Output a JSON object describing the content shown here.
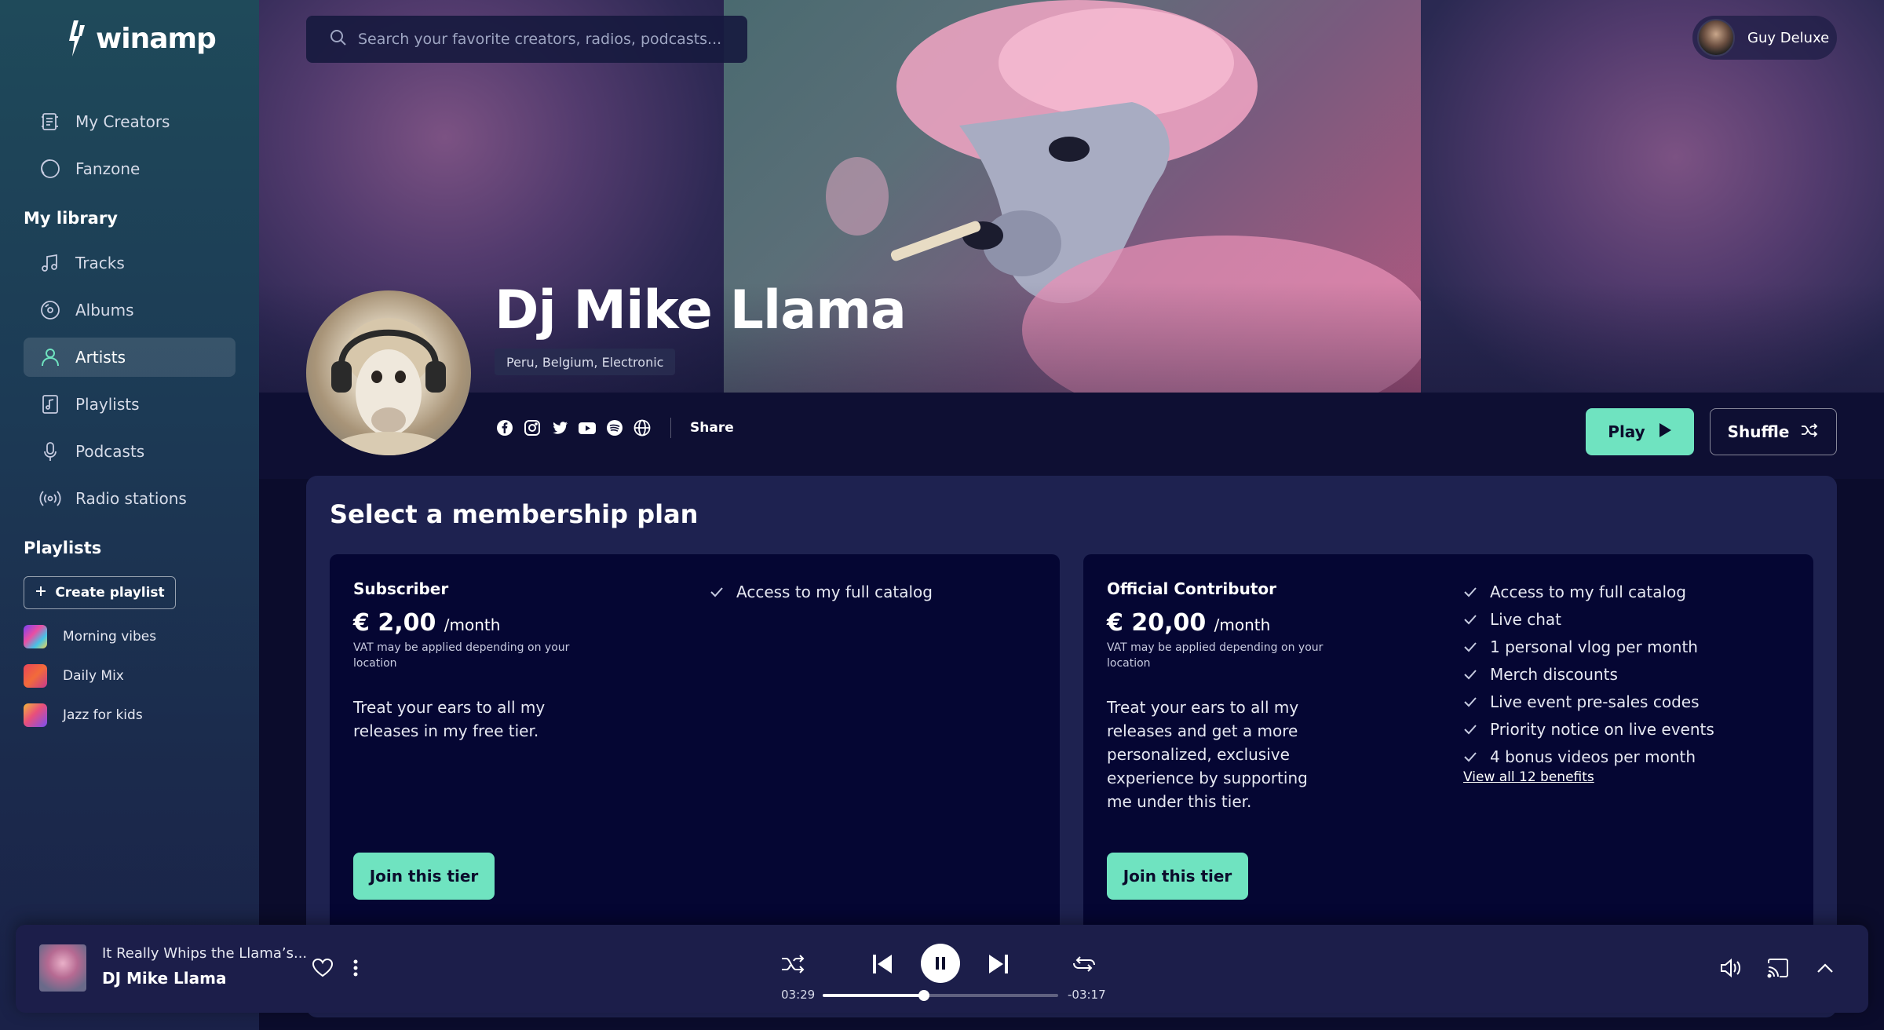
{
  "app": {
    "name": "winamp"
  },
  "nav": {
    "my_creators": "My Creators",
    "fanzone": "Fanzone",
    "library_title": "My library",
    "tracks": "Tracks",
    "albums": "Albums",
    "artists": "Artists",
    "playlists": "Playlists",
    "podcasts": "Podcasts",
    "radio": "Radio stations"
  },
  "playlists_section": {
    "title": "Playlists",
    "create_label": "Create playlist",
    "items": [
      {
        "label": "Morning vibes"
      },
      {
        "label": "Daily Mix"
      },
      {
        "label": "Jazz for kids"
      }
    ]
  },
  "search": {
    "placeholder": "Search your favorite creators, radios, podcasts..."
  },
  "user": {
    "name": "Guy Deluxe"
  },
  "artist": {
    "name": "Dj Mike Llama",
    "tags": "Peru, Belgium, Electronic",
    "share_label": "Share",
    "play_label": "Play",
    "shuffle_label": "Shuffle"
  },
  "membership": {
    "title": "Select a membership plan",
    "tiers": [
      {
        "name": "Subscriber",
        "price": "€ 2,00",
        "period": "/month",
        "vat_note": "VAT may be applied depending on your location",
        "description": "Treat your ears to all my releases in my free tier.",
        "benefits": [
          "Access to my full catalog"
        ],
        "join_label": "Join this tier"
      },
      {
        "name": "Official Contributor",
        "price": "€ 20,00",
        "period": "/month",
        "vat_note": "VAT may be applied depending on your location",
        "description": "Treat your ears to all my releases and get a more personalized, exclusive experience by supporting me under this tier.",
        "benefits": [
          "Access to my full catalog",
          "Live chat",
          "1 personal vlog per month",
          "Merch discounts",
          "Live event pre-sales codes",
          "Priority notice on live events",
          "4 bonus videos per month"
        ],
        "view_all_label": "View all 12 benefits",
        "join_label": "Join this tier"
      }
    ]
  },
  "player": {
    "track_title": "It Really Whips the Llama’s...",
    "track_artist": "DJ Mike Llama",
    "elapsed": "03:29",
    "remaining": "-03:17",
    "progress": 0.43
  },
  "colors": {
    "accent": "#6fe3c0",
    "background": "#0b0c2c",
    "panel": "#1e2250",
    "card": "#050633"
  }
}
